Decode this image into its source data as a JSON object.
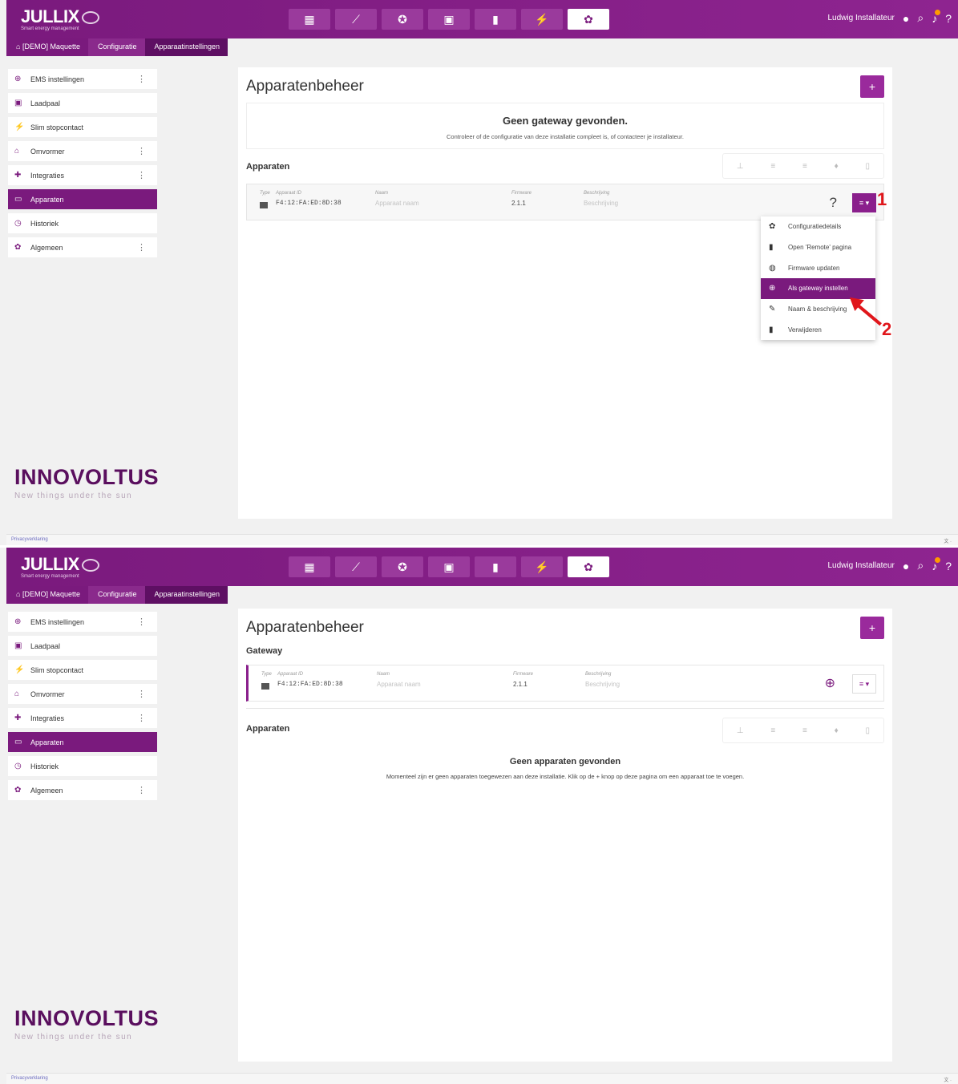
{
  "app": {
    "logo": "JULLIX",
    "logo_sub": "Smart energy management",
    "user_name": "Ludwig Installateur",
    "nav_icons": [
      "dashboard-icon",
      "chart-icon",
      "brain-icon",
      "money-icon",
      "battery-icon",
      "plug-icon",
      "gear-icon"
    ]
  },
  "breadcrumb": {
    "home": "[DEMO] Maquette",
    "config": "Configuratie",
    "page": "Apparaatinstellingen"
  },
  "sidebar": {
    "items": [
      {
        "label": "EMS instellingen",
        "icon": "cog-chip-icon",
        "kebab": true
      },
      {
        "label": "Laadpaal",
        "icon": "charger-icon",
        "kebab": false
      },
      {
        "label": "Slim stopcontact",
        "icon": "plug-icon",
        "kebab": false
      },
      {
        "label": "Omvormer",
        "icon": "home-icon",
        "kebab": true
      },
      {
        "label": "Integraties",
        "icon": "puzzle-icon",
        "kebab": true
      },
      {
        "label": "Apparaten",
        "icon": "devices-icon",
        "kebab": false,
        "active": true
      },
      {
        "label": "Historiek",
        "icon": "history-icon",
        "kebab": false
      },
      {
        "label": "Algemeen",
        "icon": "gear-icon",
        "kebab": true
      }
    ]
  },
  "brand": {
    "name": "INNOVOLTUS",
    "tagline": "New things under the sun"
  },
  "footer": {
    "privacy": "Privacyverklaring",
    "lang": "文 ·"
  },
  "top": {
    "title": "Apparatenbeheer",
    "plus": "+",
    "notice_title": "Geen gateway gevonden.",
    "notice_body": "Controleer of de configuratie van deze installatie compleet is, of contacteer je installateur.",
    "devices_title": "Apparaten",
    "columns": {
      "type": "Type",
      "id": "Apparaat ID",
      "name": "Naam",
      "firmware": "Firmware",
      "desc": "Beschrijving"
    },
    "device": {
      "id": "F4:12:FA:ED:8D:38",
      "name": "Apparaat naam",
      "firmware": "2.1.1",
      "desc": "Beschrijving"
    },
    "question": "?",
    "menu_btn": "≡ ▾",
    "dropdown": [
      {
        "label": "Configuratiedetails",
        "icon": "gear-icon"
      },
      {
        "label": "Open 'Remote' pagina",
        "icon": "remote-icon"
      },
      {
        "label": "Firmware updaten",
        "icon": "globe-icon"
      },
      {
        "label": "Als gateway instellen",
        "icon": "gateway-icon",
        "highlighted": true
      },
      {
        "label": "Naam & beschrijving",
        "icon": "edit-icon"
      },
      {
        "label": "Verwijderen",
        "icon": "trash-icon"
      }
    ],
    "annotation_1": "1",
    "annotation_2": "2"
  },
  "bottom": {
    "title": "Apparatenbeheer",
    "plus": "+",
    "gateway_title": "Gateway",
    "columns": {
      "type": "Type",
      "id": "Apparaat ID",
      "name": "Naam",
      "firmware": "Firmware",
      "desc": "Beschrijving"
    },
    "device": {
      "id": "F4:12:FA:ED:8D:38",
      "name": "Apparaat naam",
      "firmware": "2.1.1",
      "desc": "Beschrijving"
    },
    "menu_btn": "≡ ▾",
    "devices_title": "Apparaten",
    "empty_title": "Geen apparaten gevonden",
    "empty_body": "Momenteel zijn er geen apparaten toegewezen aan deze installatie. Klik op de + knop op deze pagina om een apparaat toe te voegen."
  },
  "colors": {
    "brand": "#7a1a7d",
    "accent": "#9a2a9c",
    "annotation": "#e0161b"
  }
}
